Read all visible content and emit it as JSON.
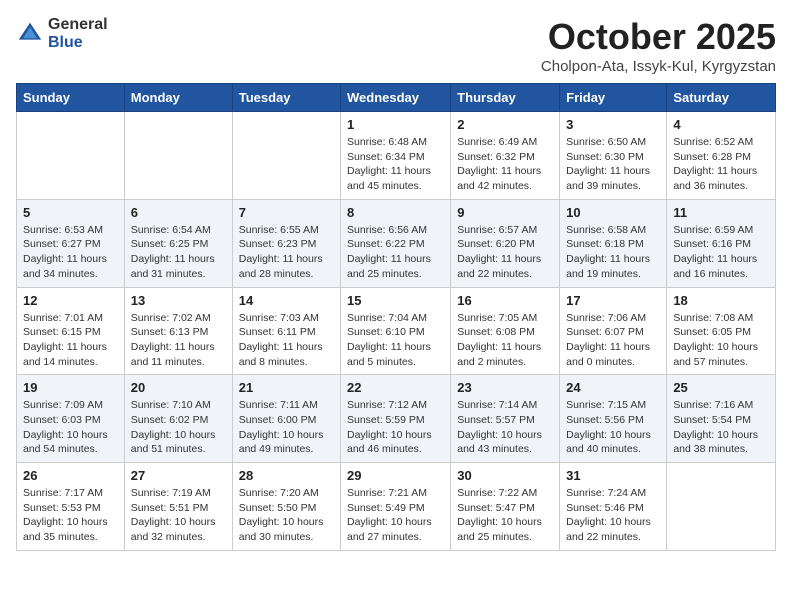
{
  "header": {
    "logo_general": "General",
    "logo_blue": "Blue",
    "month": "October 2025",
    "location": "Cholpon-Ata, Issyk-Kul, Kyrgyzstan"
  },
  "days_of_week": [
    "Sunday",
    "Monday",
    "Tuesday",
    "Wednesday",
    "Thursday",
    "Friday",
    "Saturday"
  ],
  "weeks": [
    {
      "row_style": "row-white",
      "days": [
        {
          "number": "",
          "info": ""
        },
        {
          "number": "",
          "info": ""
        },
        {
          "number": "",
          "info": ""
        },
        {
          "number": "1",
          "info": "Sunrise: 6:48 AM\nSunset: 6:34 PM\nDaylight: 11 hours\nand 45 minutes."
        },
        {
          "number": "2",
          "info": "Sunrise: 6:49 AM\nSunset: 6:32 PM\nDaylight: 11 hours\nand 42 minutes."
        },
        {
          "number": "3",
          "info": "Sunrise: 6:50 AM\nSunset: 6:30 PM\nDaylight: 11 hours\nand 39 minutes."
        },
        {
          "number": "4",
          "info": "Sunrise: 6:52 AM\nSunset: 6:28 PM\nDaylight: 11 hours\nand 36 minutes."
        }
      ]
    },
    {
      "row_style": "row-alt",
      "days": [
        {
          "number": "5",
          "info": "Sunrise: 6:53 AM\nSunset: 6:27 PM\nDaylight: 11 hours\nand 34 minutes."
        },
        {
          "number": "6",
          "info": "Sunrise: 6:54 AM\nSunset: 6:25 PM\nDaylight: 11 hours\nand 31 minutes."
        },
        {
          "number": "7",
          "info": "Sunrise: 6:55 AM\nSunset: 6:23 PM\nDaylight: 11 hours\nand 28 minutes."
        },
        {
          "number": "8",
          "info": "Sunrise: 6:56 AM\nSunset: 6:22 PM\nDaylight: 11 hours\nand 25 minutes."
        },
        {
          "number": "9",
          "info": "Sunrise: 6:57 AM\nSunset: 6:20 PM\nDaylight: 11 hours\nand 22 minutes."
        },
        {
          "number": "10",
          "info": "Sunrise: 6:58 AM\nSunset: 6:18 PM\nDaylight: 11 hours\nand 19 minutes."
        },
        {
          "number": "11",
          "info": "Sunrise: 6:59 AM\nSunset: 6:16 PM\nDaylight: 11 hours\nand 16 minutes."
        }
      ]
    },
    {
      "row_style": "row-white",
      "days": [
        {
          "number": "12",
          "info": "Sunrise: 7:01 AM\nSunset: 6:15 PM\nDaylight: 11 hours\nand 14 minutes."
        },
        {
          "number": "13",
          "info": "Sunrise: 7:02 AM\nSunset: 6:13 PM\nDaylight: 11 hours\nand 11 minutes."
        },
        {
          "number": "14",
          "info": "Sunrise: 7:03 AM\nSunset: 6:11 PM\nDaylight: 11 hours\nand 8 minutes."
        },
        {
          "number": "15",
          "info": "Sunrise: 7:04 AM\nSunset: 6:10 PM\nDaylight: 11 hours\nand 5 minutes."
        },
        {
          "number": "16",
          "info": "Sunrise: 7:05 AM\nSunset: 6:08 PM\nDaylight: 11 hours\nand 2 minutes."
        },
        {
          "number": "17",
          "info": "Sunrise: 7:06 AM\nSunset: 6:07 PM\nDaylight: 11 hours\nand 0 minutes."
        },
        {
          "number": "18",
          "info": "Sunrise: 7:08 AM\nSunset: 6:05 PM\nDaylight: 10 hours\nand 57 minutes."
        }
      ]
    },
    {
      "row_style": "row-alt",
      "days": [
        {
          "number": "19",
          "info": "Sunrise: 7:09 AM\nSunset: 6:03 PM\nDaylight: 10 hours\nand 54 minutes."
        },
        {
          "number": "20",
          "info": "Sunrise: 7:10 AM\nSunset: 6:02 PM\nDaylight: 10 hours\nand 51 minutes."
        },
        {
          "number": "21",
          "info": "Sunrise: 7:11 AM\nSunset: 6:00 PM\nDaylight: 10 hours\nand 49 minutes."
        },
        {
          "number": "22",
          "info": "Sunrise: 7:12 AM\nSunset: 5:59 PM\nDaylight: 10 hours\nand 46 minutes."
        },
        {
          "number": "23",
          "info": "Sunrise: 7:14 AM\nSunset: 5:57 PM\nDaylight: 10 hours\nand 43 minutes."
        },
        {
          "number": "24",
          "info": "Sunrise: 7:15 AM\nSunset: 5:56 PM\nDaylight: 10 hours\nand 40 minutes."
        },
        {
          "number": "25",
          "info": "Sunrise: 7:16 AM\nSunset: 5:54 PM\nDaylight: 10 hours\nand 38 minutes."
        }
      ]
    },
    {
      "row_style": "row-white",
      "days": [
        {
          "number": "26",
          "info": "Sunrise: 7:17 AM\nSunset: 5:53 PM\nDaylight: 10 hours\nand 35 minutes."
        },
        {
          "number": "27",
          "info": "Sunrise: 7:19 AM\nSunset: 5:51 PM\nDaylight: 10 hours\nand 32 minutes."
        },
        {
          "number": "28",
          "info": "Sunrise: 7:20 AM\nSunset: 5:50 PM\nDaylight: 10 hours\nand 30 minutes."
        },
        {
          "number": "29",
          "info": "Sunrise: 7:21 AM\nSunset: 5:49 PM\nDaylight: 10 hours\nand 27 minutes."
        },
        {
          "number": "30",
          "info": "Sunrise: 7:22 AM\nSunset: 5:47 PM\nDaylight: 10 hours\nand 25 minutes."
        },
        {
          "number": "31",
          "info": "Sunrise: 7:24 AM\nSunset: 5:46 PM\nDaylight: 10 hours\nand 22 minutes."
        },
        {
          "number": "",
          "info": ""
        }
      ]
    }
  ]
}
